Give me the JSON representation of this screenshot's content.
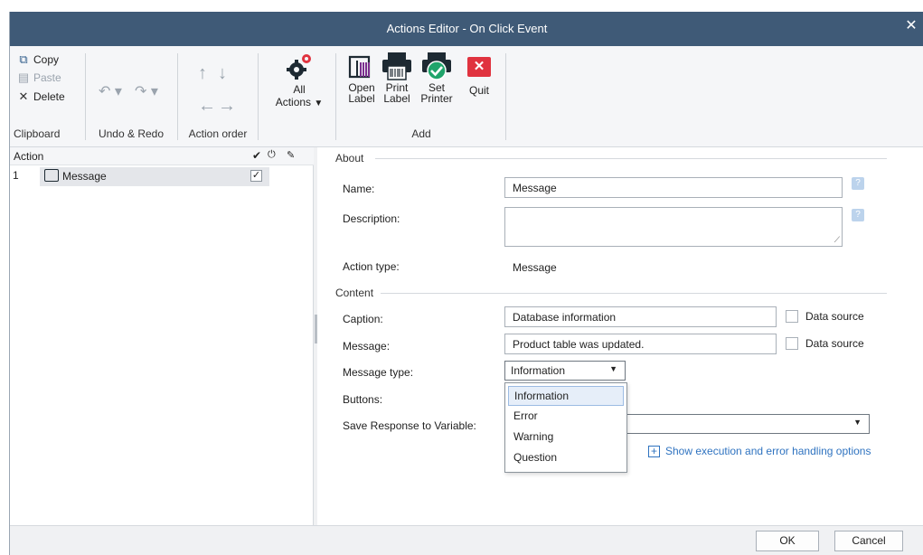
{
  "window": {
    "title": "Actions Editor - On Click Event",
    "close": "✕"
  },
  "ribbon": {
    "clipboard": {
      "copy": "Copy",
      "paste": "Paste",
      "delete": "Delete",
      "label": "Clipboard"
    },
    "undo_redo": {
      "undo_symbol": "↶ ▾",
      "redo_symbol": "↷ ▾",
      "label": "Undo & Redo"
    },
    "action_order": {
      "label": "Action order",
      "up": "↑",
      "down": "↓",
      "left": "←",
      "right": "→"
    },
    "all_actions": {
      "line1": "All",
      "line2": "Actions",
      "caret": "▼"
    },
    "add": {
      "label": "Add",
      "open_label": [
        "Open",
        "Label"
      ],
      "print_label": [
        "Print",
        "Label"
      ],
      "set_printer": [
        "Set",
        "Printer"
      ],
      "quit": "Quit"
    }
  },
  "action_list": {
    "header": "Action",
    "rows": [
      {
        "number": "1",
        "name": "Message",
        "enabled": "✓"
      }
    ]
  },
  "about": {
    "title": "About",
    "name_label": "Name:",
    "name_value": "Message",
    "description_label": "Description:",
    "description_value": "",
    "action_type_label": "Action type:",
    "action_type_value": "Message"
  },
  "content": {
    "title": "Content",
    "caption_label": "Caption:",
    "caption_value": "Database information",
    "message_label": "Message:",
    "message_value": "Product table was updated.",
    "data_source": "Data source",
    "message_type_label": "Message type:",
    "message_type_value": "Information",
    "message_type_options": [
      "Information",
      "Error",
      "Warning",
      "Question"
    ],
    "buttons_label": "Buttons:",
    "save_response_label": "Save Response to Variable:",
    "execution_link": "Show execution and error handling options"
  },
  "footer": {
    "ok": "OK",
    "cancel": "Cancel"
  },
  "colors": {
    "titlebar": "#3f5a77",
    "link": "#2f73c0",
    "quit_red": "#e0333f",
    "set_printer_green": "#20a46b"
  }
}
